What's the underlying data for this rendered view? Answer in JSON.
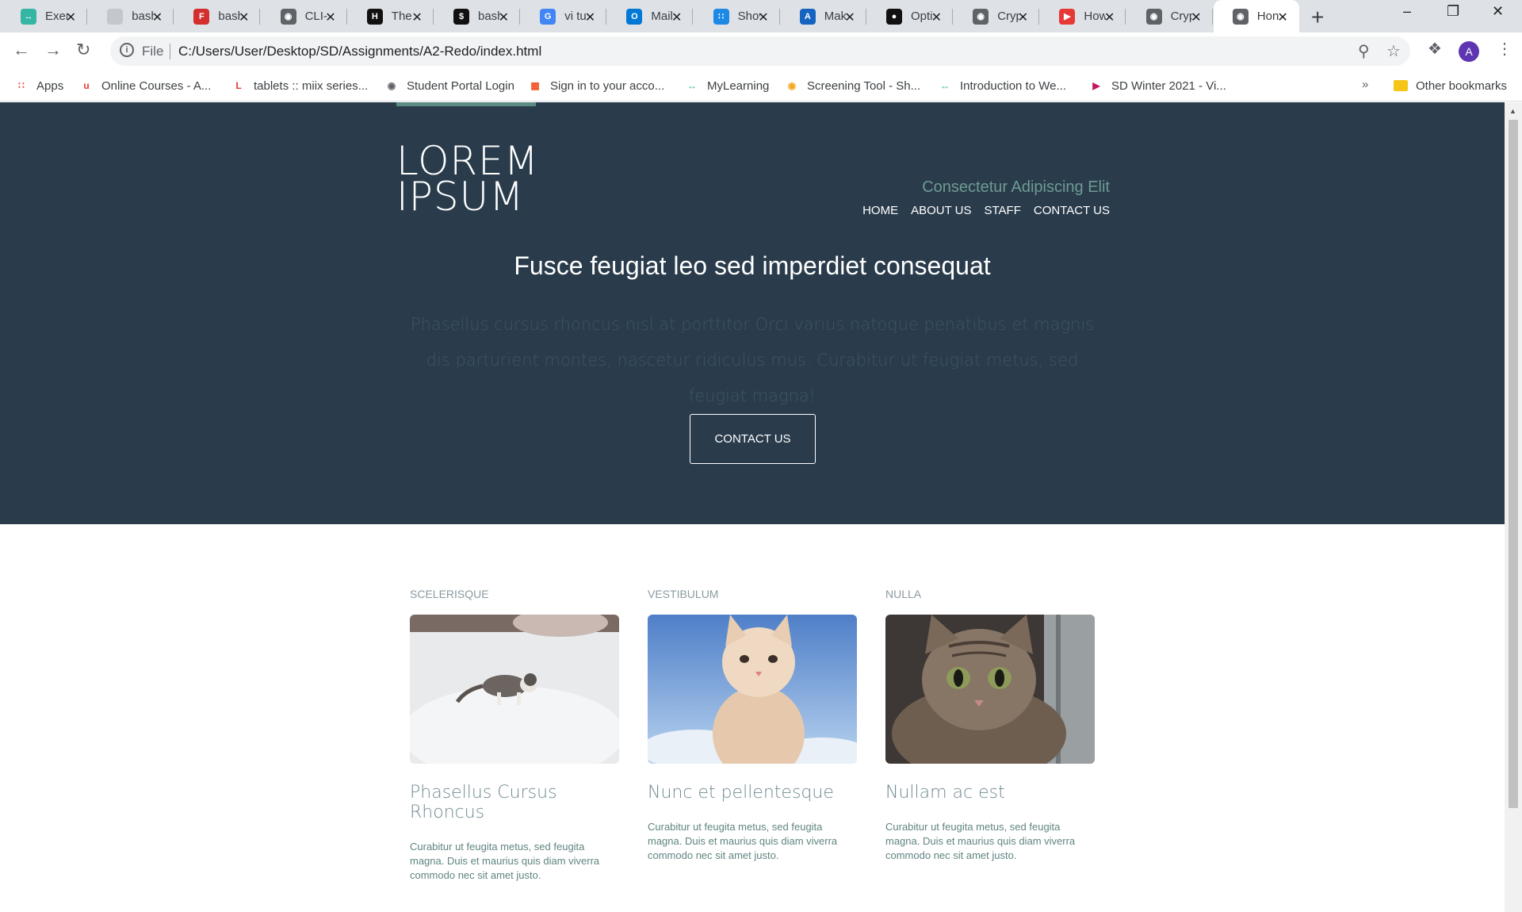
{
  "browser": {
    "tabs": [
      {
        "title": "Exer",
        "icon": "stripe-link-icon",
        "color": "#35b5a4"
      },
      {
        "title": "bash",
        "icon": "blank-page-icon",
        "color": "#c4c7cc"
      },
      {
        "title": "bash",
        "icon": "f-logo-icon",
        "color": "#d32f2f"
      },
      {
        "title": "CLI-",
        "icon": "globe-icon",
        "color": "#5f6368"
      },
      {
        "title": "The",
        "icon": "htg-icon",
        "color": "#111111"
      },
      {
        "title": "bash",
        "icon": "terminal-icon",
        "color": "#111111"
      },
      {
        "title": "vi tu",
        "icon": "google-icon",
        "color": "#4285f4"
      },
      {
        "title": "Mail",
        "icon": "outlook-icon",
        "color": "#0078d4"
      },
      {
        "title": "Shov",
        "icon": "dots-icon",
        "color": "#1e88e5"
      },
      {
        "title": "Mak",
        "icon": "a-logo-icon",
        "color": "#1565c0"
      },
      {
        "title": "Opti",
        "icon": "github-icon",
        "color": "#111111"
      },
      {
        "title": "Cryp",
        "icon": "globe-icon",
        "color": "#5f6368"
      },
      {
        "title": "How",
        "icon": "play-icon",
        "color": "#e53935"
      },
      {
        "title": "Cryp",
        "icon": "globe-icon",
        "color": "#5f6368"
      },
      {
        "title": "Hon",
        "icon": "globe-icon",
        "color": "#5f6368",
        "active": true
      }
    ],
    "url_scheme": "File",
    "url": "C:/Users/User/Desktop/SD/Assignments/A2-Redo/index.html",
    "avatar_letter": "A",
    "bookmarks": [
      {
        "label": "Apps",
        "color": "#ea4335"
      },
      {
        "label": "Online Courses - A...",
        "color": "#e53935"
      },
      {
        "label": "tablets :: miix series...",
        "color": "#e53935"
      },
      {
        "label": "Student Portal Login",
        "color": "#5f6368"
      },
      {
        "label": "Sign in to your acco...",
        "color": "#f25022"
      },
      {
        "label": "MyLearning",
        "color": "#35b5a4"
      },
      {
        "label": "Screening Tool - Sh...",
        "color": "#f4a71d"
      },
      {
        "label": "Introduction to We...",
        "color": "#35b5a4"
      },
      {
        "label": "SD Winter 2021 - Vi...",
        "color": "#c2185b"
      }
    ],
    "bookmarks_more": "»",
    "other_bookmarks": "Other bookmarks"
  },
  "page": {
    "logo_line1": "LOREM",
    "logo_line2": "IPSUM",
    "tagline": "Consectetur Adipiscing Elit",
    "nav": [
      "HOME",
      "ABOUT US",
      "STAFF",
      "CONTACT US"
    ],
    "hero_title": "Fusce feugiat leo sed imperdiet consequat",
    "hero_text": "Phasellus cursus rhoncus nisl at porttitor Orci varius natoque penatibus et magnis dis parturient montes, nascetur ridiculus mus. Curabitur ut feugiat metus, sed feugiat magna!",
    "hero_button": "CONTACT US",
    "cards": [
      {
        "label": "SCELERISQUE",
        "title": "Phasellus Cursus Rhoncus",
        "desc": "Curabitur ut feugita metus, sed feugita magna. Duis et maurius quis diam viverra commodo nec sit amet justo."
      },
      {
        "label": "VESTIBULUM",
        "title": "Nunc et pellentesque",
        "desc": "Curabitur ut feugita metus, sed feugita magna. Duis et maurius quis diam viverra commodo nec sit amet justo."
      },
      {
        "label": "NULLA",
        "title": "Nullam ac est",
        "desc": "Curabitur ut feugita metus, sed feugita magna. Duis et maurius quis diam viverra commodo nec sit amet justo."
      }
    ]
  }
}
